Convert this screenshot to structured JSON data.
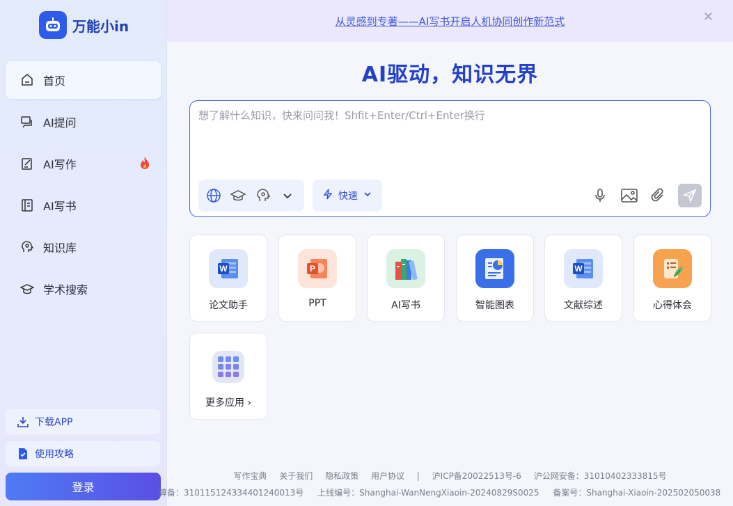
{
  "app": {
    "name": "万能小in"
  },
  "sidebar": {
    "items": [
      {
        "label": "首页",
        "icon": "home-icon",
        "active": true
      },
      {
        "label": "AI提问",
        "icon": "chat-icon"
      },
      {
        "label": "AI写作",
        "icon": "edit-icon",
        "badge": "fire-icon"
      },
      {
        "label": "AI写书",
        "icon": "book-icon"
      },
      {
        "label": "知识库",
        "icon": "brain-icon"
      },
      {
        "label": "学术搜索",
        "icon": "mortarboard-icon"
      }
    ],
    "download_label": "下载APP",
    "guide_label": "使用攻略",
    "login_label": "登录"
  },
  "banner": {
    "text": "从灵感到专著——AI写书开启人机协同创作新范式",
    "close": "✕"
  },
  "main": {
    "hero": "AI驱动，知识无界",
    "input": {
      "placeholder": "想了解什么知识，快来问问我！Shfit+Enter/Ctrl+Enter换行",
      "value": "",
      "mode_label": "快速"
    },
    "apps": [
      {
        "label": "论文助手",
        "icon": "word-doc-icon"
      },
      {
        "label": "PPT",
        "icon": "ppt-icon"
      },
      {
        "label": "AI写书",
        "icon": "books-icon"
      },
      {
        "label": "智能图表",
        "icon": "chart-icon"
      },
      {
        "label": "文献综述",
        "icon": "word-doc-icon"
      },
      {
        "label": "心得体会",
        "icon": "notes-feather-icon"
      },
      {
        "label": "更多应用",
        "icon": "apps-grid-icon"
      }
    ]
  },
  "footer": {
    "links": [
      "写作宝典",
      "关于我们",
      "隐私政策",
      "用户协议",
      "|",
      "沪ICP备20022513号-6",
      "沪公网安备：31010402333815号"
    ],
    "line2": [
      "算备：310115124334401240013号",
      "上线编号：Shanghai-WanNengXiaoin-20240829S0025",
      "备案号：Shanghai-Xiaoin-202502050038"
    ]
  },
  "colors": {
    "accent": "#2341c8",
    "brand": "#2f5bea"
  }
}
